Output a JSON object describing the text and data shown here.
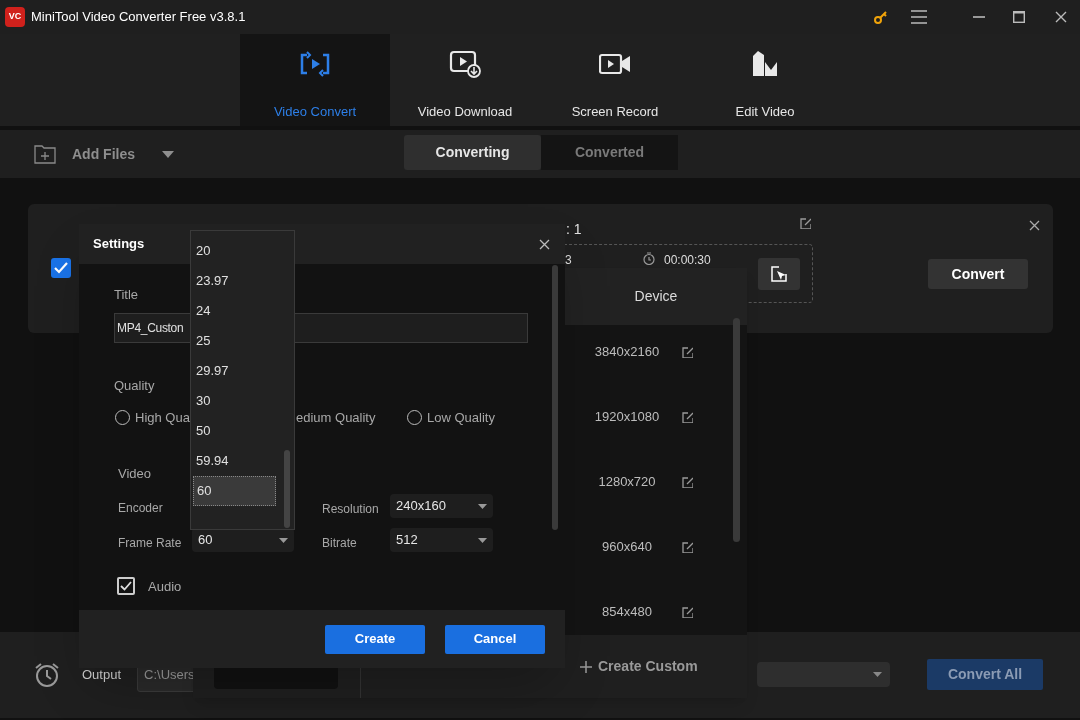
{
  "window": {
    "title": "MiniTool Video Converter Free v3.8.1",
    "logo": "VC"
  },
  "nav_tabs": [
    {
      "kind": "convert",
      "label": "Video Convert",
      "selected": true
    },
    {
      "kind": "download",
      "label": "Video Download",
      "selected": false
    },
    {
      "kind": "record",
      "label": "Screen Record",
      "selected": false
    },
    {
      "kind": "edit",
      "label": "Edit Video",
      "selected": false
    }
  ],
  "toolbar": {
    "add_files": "Add Files",
    "tabs": [
      {
        "label": "Converting",
        "selected": true
      },
      {
        "label": "Converted",
        "selected": false
      }
    ]
  },
  "file_card": {
    "checked": true,
    "target_fragment": ": 1",
    "format_fragment": "3",
    "duration": "00:00:30",
    "convert_button": "Convert"
  },
  "format_panel": {
    "tab": "Device",
    "resolutions": [
      "3840x2160",
      "1920x1080",
      "1280x720",
      "960x640",
      "854x480"
    ],
    "create_custom": "Create Custom"
  },
  "bottom_bar": {
    "output_label": "Output",
    "output_path": "C:\\Users",
    "convert_all": {
      "label": "Convert All",
      "disabled": true
    }
  },
  "settings_dialog": {
    "title": "Settings",
    "title_label": "Title",
    "title_value": "MP4_Custon",
    "quality_label": "Quality",
    "quality_options": [
      {
        "kind": "radio",
        "label": "High Qua",
        "selected": false
      },
      {
        "kind": "fragment",
        "label": "edium Quality"
      },
      {
        "kind": "radio",
        "label": "Low Quality",
        "selected": false
      }
    ],
    "video_label": "Video",
    "encoder_label": "Encoder",
    "resolution": {
      "label": "Resolution",
      "value": "240x160"
    },
    "frame_rate": {
      "label": "Frame Rate",
      "value": "60"
    },
    "bitrate": {
      "label": "Bitrate",
      "value": "512"
    },
    "audio": {
      "label": "Audio",
      "checked": true
    },
    "buttons": [
      "Create",
      "Cancel"
    ]
  },
  "frame_rate_dropdown": {
    "options": [
      {
        "label": "20",
        "selected": false
      },
      {
        "label": "23.97",
        "selected": false
      },
      {
        "label": "24",
        "selected": false
      },
      {
        "label": "25",
        "selected": false
      },
      {
        "label": "29.97",
        "selected": false
      },
      {
        "label": "30",
        "selected": false
      },
      {
        "label": "50",
        "selected": false
      },
      {
        "label": "59.94",
        "selected": false
      },
      {
        "label": "60",
        "selected": true
      }
    ]
  }
}
